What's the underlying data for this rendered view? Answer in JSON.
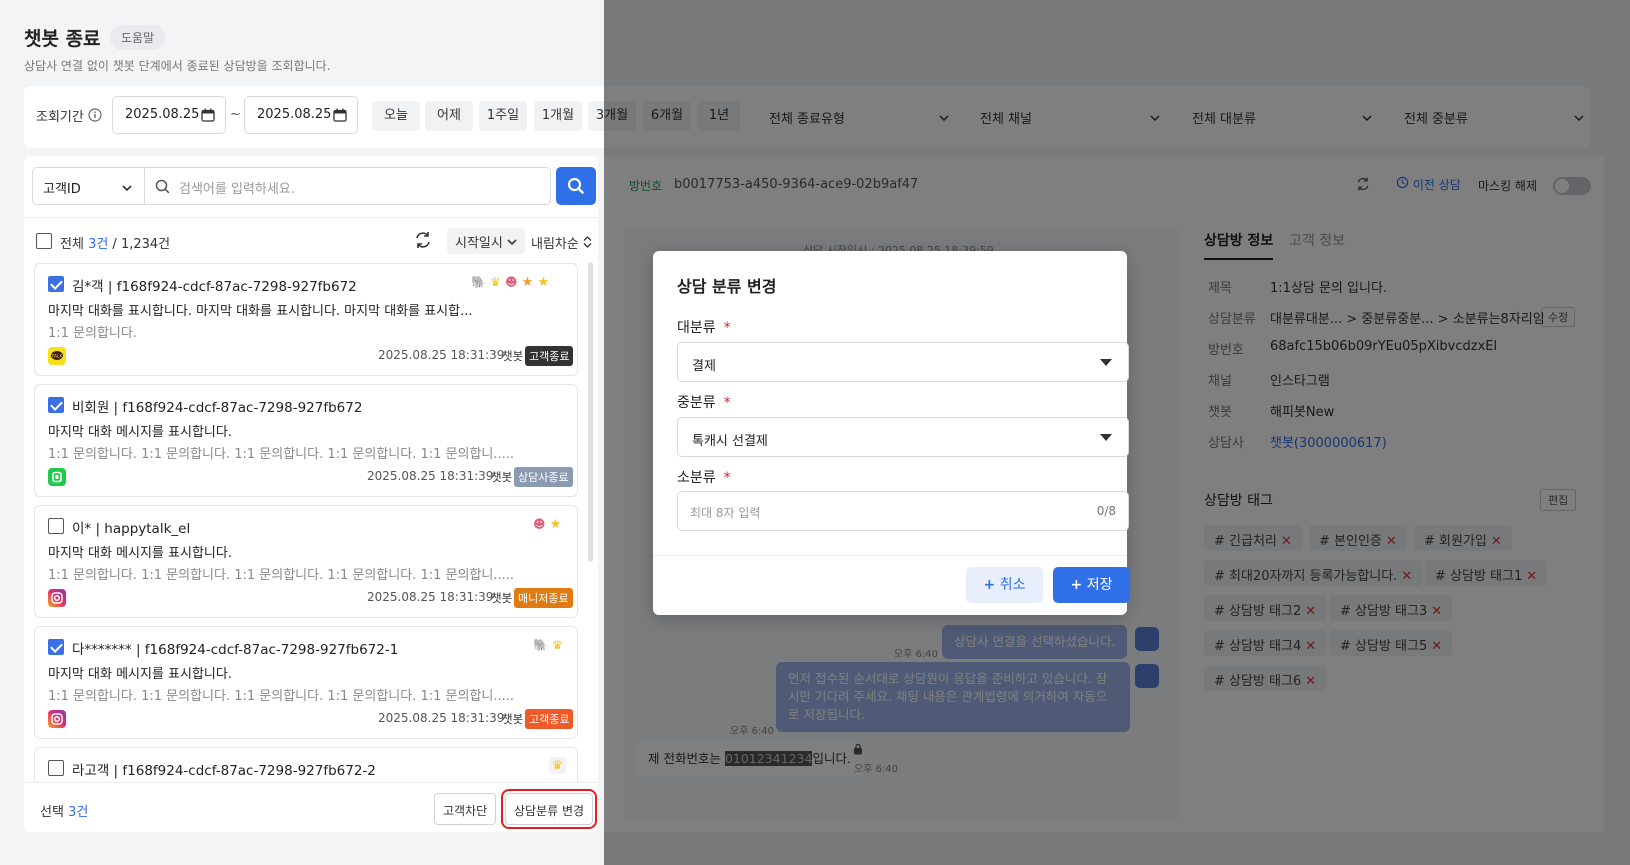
{
  "header": {
    "title": "챗봇 종료",
    "help": "도움말",
    "description": "상담사 연결 없이 챗봇 단계에서 종료된 상담방을 조회합니다."
  },
  "filter": {
    "date_label": "조회기간",
    "date_from": "2025.08.25",
    "date_sep": "~",
    "date_to": "2025.08.25",
    "quick": [
      "오늘",
      "어제",
      "1주일",
      "1개월",
      "3개월",
      "6개월",
      "1년"
    ],
    "dropdowns": [
      "전체 종료유형",
      "전체 채널",
      "전체 대분류",
      "전체 중분류"
    ]
  },
  "search": {
    "field": "고객ID",
    "placeholder": "검색어를 입력하세요."
  },
  "list": {
    "all_label": "전체",
    "count": "3건",
    "sep": " / ",
    "total": "1,234건",
    "sort_field": "시작일시",
    "sort_order": "내림차순",
    "items": [
      {
        "title": "김*객 | f168f924-cdcf-87ac-7298-927fb672",
        "line1": "마지막 대화를 표시합니다.  마지막 대화를 표시합니다. 마지막 대화를 표시합...",
        "line2": "1:1 문의합니다.",
        "date": "2025.08.25 18:31:39",
        "type": "챗봇",
        "badge": "고객종료",
        "badge_color": "#333333",
        "channel_color": "#f7df1e",
        "checked": true
      },
      {
        "title": "비회원 | f168f924-cdcf-87ac-7298-927fb672",
        "line1": "마지막 대화 메시지를 표시합니다.",
        "line2": "1:1 문의합니다. 1:1 문의합니다. 1:1 문의합니다. 1:1 문의합니다. 1:1 문의합니.....",
        "date": "2025.08.25 18:31:39",
        "type": "챗봇",
        "badge": "상담사종료",
        "badge_color": "#8a9ab0",
        "channel_color": "#1fcc4a",
        "checked": true
      },
      {
        "title": "이* | happytalk_el",
        "line1": "마지막 대화 메시지를 표시합니다.",
        "line2": "1:1 문의합니다. 1:1 문의합니다. 1:1 문의합니다. 1:1 문의합니다. 1:1 문의합니.....",
        "date": "2025.08.25 18:31:39",
        "type": "챗봇",
        "badge": "매니저종료",
        "badge_color": "#e07b12",
        "channel_color": "#c13584",
        "checked": false
      },
      {
        "title": "다******* | f168f924-cdcf-87ac-7298-927fb672-1",
        "line1": "마지막 대화 메시지를 표시합니다.",
        "line2": "1:1 문의합니다. 1:1 문의합니다. 1:1 문의합니다. 1:1 문의합니다. 1:1 문의합니.....",
        "date": "2025.08.25 18:31:39",
        "type": "챗봇",
        "badge": "고객종료",
        "badge_color": "#f05a28",
        "channel_color": "#c13584",
        "checked": true
      },
      {
        "title": "라고객 | f168f924-cdcf-87ac-7298-927fb672-2",
        "checked": false
      }
    ]
  },
  "bottom": {
    "selected_label": "선택",
    "selected_count": "3건",
    "block_btn": "고객차단",
    "change_btn": "상담분류 변경"
  },
  "room": {
    "label": "방번호",
    "id": "b0017753-a450-9364-ace9-02b9af47",
    "prev": "이전 상담",
    "masking": "마스킹 해제",
    "start": "상담 시작일시 : 2025.08.25 18:39:59"
  },
  "info": {
    "tabs": [
      "상담방 정보",
      "고객 정보"
    ],
    "rows": [
      {
        "label": "제목",
        "value": "1:1상담 문의 입니다."
      },
      {
        "label": "상담분류",
        "value": "대분류대분... > 중분류중분... > 소분류는8자리임"
      },
      {
        "label": "방번호",
        "value": "68afc15b06b09rYEu05pXibvcdzxEl"
      },
      {
        "label": "채널",
        "value": "인스타그램"
      },
      {
        "label": "챗봇",
        "value": "해피봇New"
      },
      {
        "label": "상담사",
        "value": "챗봇(3000000617)"
      }
    ],
    "edit": "수정",
    "tag_title": "상담방 태그",
    "tag_edit": "편집",
    "tags": [
      "# 긴급처리",
      "# 본인인증",
      "# 회원가입",
      "# 최대20자까지 등록가능합니다.",
      "# 상담방 태그1",
      "# 상담방 태그2",
      "# 상담방 태그3",
      "# 상담방 태그4",
      "# 상담방 태그5",
      "# 상담방 태그6"
    ]
  },
  "chat": {
    "msg1": "상담사 연결을 선택하셨습니다.",
    "msg2": "먼저 접수된 순서대로 상담원이 응답을 준비하고 있습니다. 잠시만 기다려 주세요. 채팅 내용은 관계법령에 의거하여 자동으로 저장됩니다.",
    "msg3_pre": "제 전화번호는 ",
    "msg3_mask": "01012341234",
    "msg3_post": "입니다.",
    "time": "오후 6:40"
  },
  "modal": {
    "title": "상담 분류 변경",
    "major_label": "대분류",
    "major_value": "결제",
    "middle_label": "중분류",
    "middle_value": "톡캐시 선결제",
    "minor_label": "소분류",
    "minor_placeholder": "최대 8자 입력",
    "minor_count": "0/8",
    "required": "*",
    "cancel": "취소",
    "save": "저장"
  },
  "colors": {
    "primary": "#2f6fe8",
    "required": "#e02020",
    "highlight": "#e02020"
  }
}
